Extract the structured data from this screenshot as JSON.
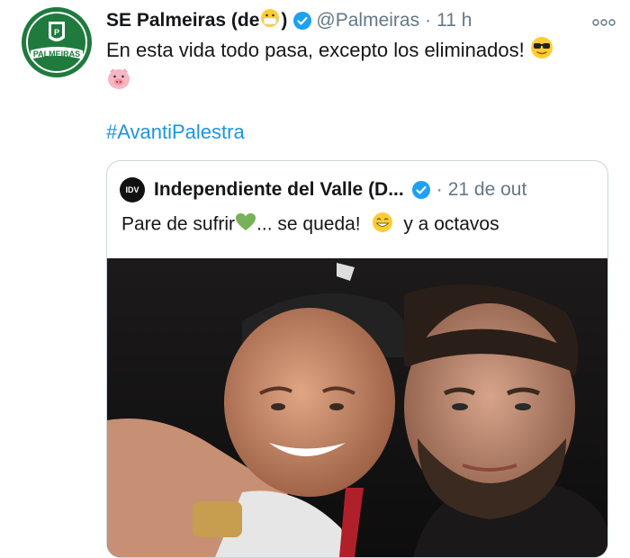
{
  "tweet": {
    "author_name": "SE Palmeiras (de",
    "author_name_suffix": ")",
    "handle": "@Palmeiras",
    "separator": "·",
    "time": "11 h",
    "text": "En esta vida todo pasa, excepto los eliminados!",
    "hashtag": "#AvantiPalestra",
    "avatar_text": "PALMEIRAS",
    "verified": true,
    "emojis": [
      "face-with-mask-icon",
      "sunglasses-face-icon",
      "pig-face-icon"
    ]
  },
  "quoted_tweet": {
    "author_name": "Independiente del Valle (D...",
    "separator": "·",
    "date": "21 de out",
    "text_part1": "Pare de sufrir",
    "text_part2": "... se queda!",
    "text_part3": "y a octavos",
    "avatar_text": "IDV",
    "verified": true,
    "emojis": [
      "green-heart-icon",
      "grinning-face-icon"
    ]
  },
  "colors": {
    "link": "#1b95e0",
    "muted": "#657786",
    "verified": "#1da1f2",
    "palmeiras_green": "#1f7a3e"
  }
}
